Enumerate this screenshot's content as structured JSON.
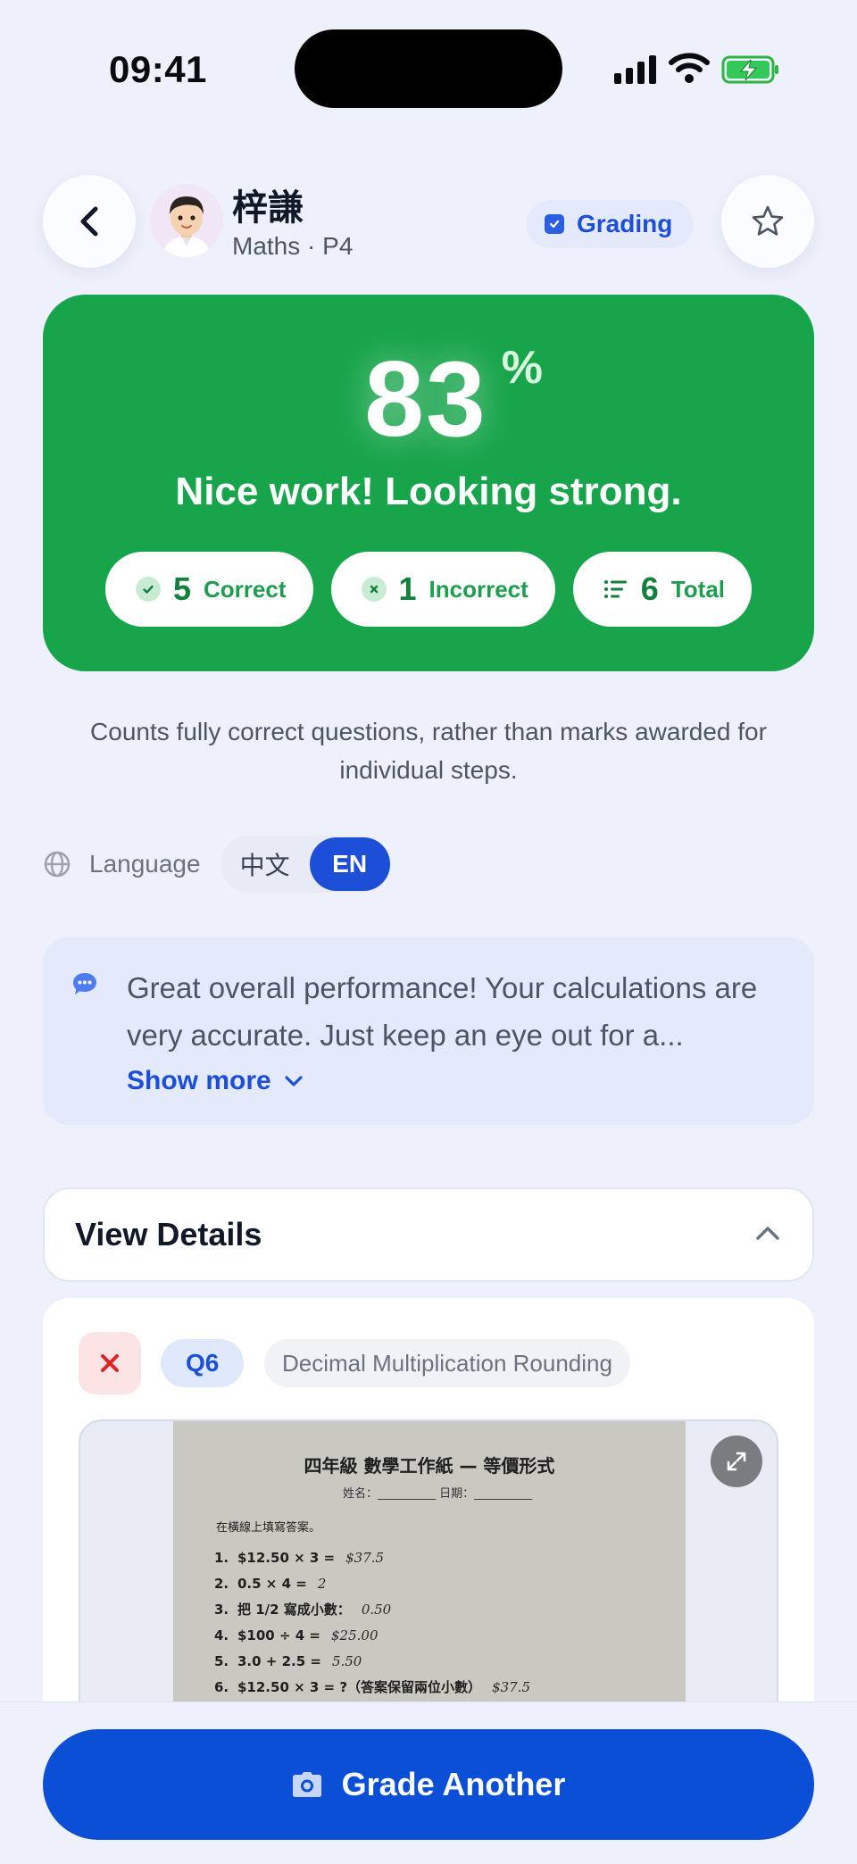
{
  "status_bar": {
    "time": "09:41"
  },
  "header": {
    "student_name": "梓謙",
    "subject": "Maths",
    "grade": "P4",
    "separator": "·",
    "status_badge": "Grading"
  },
  "score": {
    "percent": "83",
    "percent_sign": "%",
    "message": "Nice work! Looking strong.",
    "correct_count": "5",
    "correct_label": "Correct",
    "incorrect_count": "1",
    "incorrect_label": "Incorrect",
    "total_count": "6",
    "total_label": "Total"
  },
  "note": "Counts fully correct questions, rather than marks awarded for individual steps.",
  "language": {
    "label": "Language",
    "options": [
      "中文",
      "EN"
    ],
    "selected": "EN"
  },
  "feedback": {
    "text": "Great overall performance! Your calculations are very accurate. Just keep an eye out for a...",
    "show_more": "Show more"
  },
  "details": {
    "title": "View Details",
    "question": {
      "status": "incorrect",
      "number": "Q6",
      "topic": "Decimal Multiplication Rounding",
      "worksheet": {
        "title": "四年級 數學工作紙 — 等價形式",
        "name_line": "姓名：__________ 日期：__________",
        "instruction": "在橫線上填寫答案。",
        "items": [
          {
            "num": "1.",
            "question": "$12.50 × 3 =",
            "answer": "$37.5"
          },
          {
            "num": "2.",
            "question": "0.5 × 4 =",
            "answer": "2"
          },
          {
            "num": "3.",
            "question": "把 1/2 寫成小數：",
            "answer": "0.50"
          },
          {
            "num": "4.",
            "question": "$100 ÷ 4 =",
            "answer": "$25.00"
          },
          {
            "num": "5.",
            "question": "3.0 + 2.5 =",
            "answer": "5.50"
          },
          {
            "num": "6.",
            "question": "$12.50 × 3 = ?（答案保留兩位小數）",
            "answer": "$37.5"
          }
        ]
      }
    }
  },
  "bottom": {
    "button_label": "Grade Another"
  },
  "colors": {
    "score_card": "#17a44a",
    "primary": "#1d4ed8",
    "button": "#0b4fd6",
    "error": "#dc2626"
  }
}
